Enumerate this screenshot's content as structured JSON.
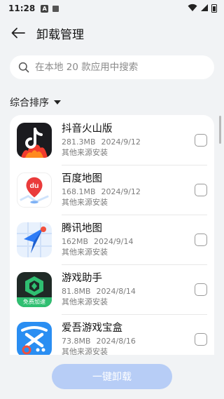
{
  "status_bar": {
    "time": "11:28",
    "app_icon_letter": "A"
  },
  "header": {
    "title": "卸载管理"
  },
  "search": {
    "placeholder": "在本地 20 款应用中搜索"
  },
  "sort": {
    "label": "综合排序"
  },
  "apps": [
    {
      "name": "抖音火山版",
      "size": "281.3MB",
      "date": "2024/9/12",
      "source": "其他来源安装",
      "icon": "douyin-huoshan-icon"
    },
    {
      "name": "百度地图",
      "size": "168.1MB",
      "date": "2024/9/12",
      "source": "其他来源安装",
      "icon": "baidu-map-icon"
    },
    {
      "name": "腾讯地图",
      "size": "162MB",
      "date": "2024/9/14",
      "source": "其他来源安装",
      "icon": "tencent-map-icon"
    },
    {
      "name": "游戏助手",
      "size": "81.8MB",
      "date": "2024/8/14",
      "source": "其他来源安装",
      "icon": "game-assistant-icon",
      "badge": "免费加速"
    },
    {
      "name": "爱吾游戏宝盒",
      "size": "73.8MB",
      "date": "2024/8/16",
      "source": "其他来源安装",
      "icon": "aiwu-game-box-icon"
    }
  ],
  "footer": {
    "button_label": "一键卸载",
    "button_color": "#b7cdf6"
  }
}
